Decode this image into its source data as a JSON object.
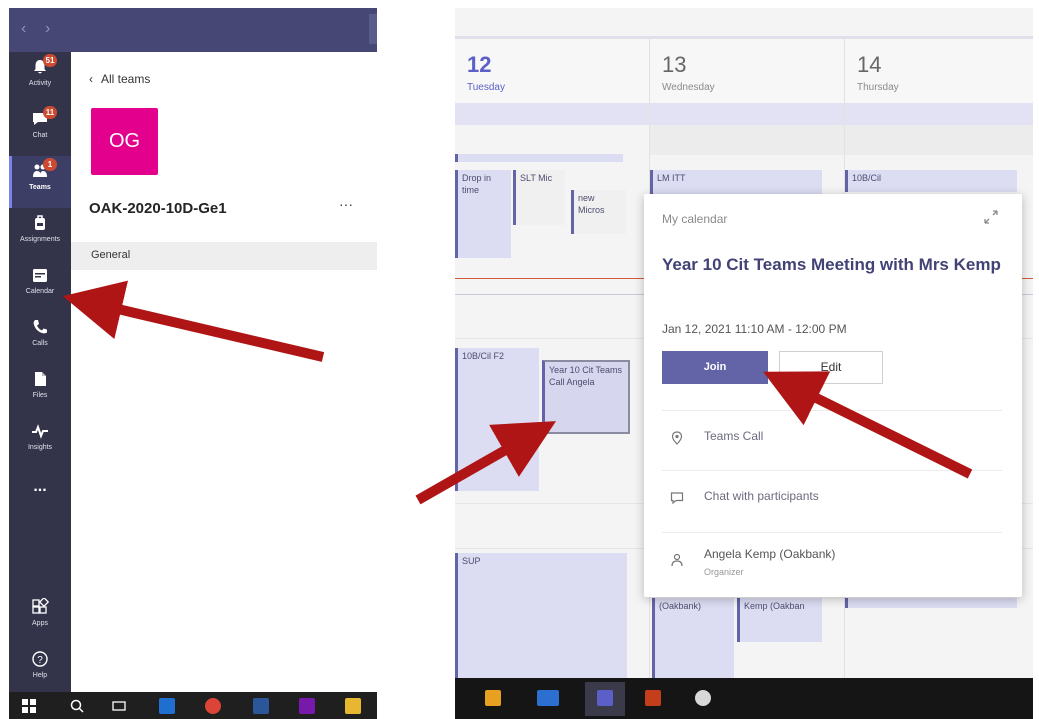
{
  "left": {
    "rail": [
      {
        "id": "activity",
        "label": "Activity",
        "badge": "51",
        "icon": "bell-icon"
      },
      {
        "id": "chat",
        "label": "Chat",
        "badge": "11",
        "icon": "chat-icon"
      },
      {
        "id": "teams",
        "label": "Teams",
        "badge": "1",
        "icon": "teams-icon",
        "active": true
      },
      {
        "id": "assignments",
        "label": "Assignments",
        "icon": "backpack-icon"
      },
      {
        "id": "calendar",
        "label": "Calendar",
        "icon": "calendar-icon"
      },
      {
        "id": "calls",
        "label": "Calls",
        "icon": "phone-icon"
      },
      {
        "id": "files",
        "label": "Files",
        "icon": "file-icon"
      },
      {
        "id": "insights",
        "label": "Insights",
        "icon": "pulse-icon"
      },
      {
        "id": "more",
        "label": "...",
        "icon": "more-icon"
      },
      {
        "id": "apps",
        "label": "Apps",
        "icon": "apps-icon"
      },
      {
        "id": "help",
        "label": "Help",
        "icon": "help-icon"
      }
    ],
    "all_teams": "All teams",
    "team_initials": "OG",
    "team_name": "OAK-2020-10D-Ge1",
    "more_dots": "···",
    "channel": "General",
    "colors": {
      "rail": "#33344a",
      "titlebar": "#464775",
      "avatar": "#e3008c",
      "badge": "#cc4a31"
    }
  },
  "calendar": {
    "days": [
      {
        "num": "12",
        "name": "Tuesday",
        "today": true
      },
      {
        "num": "13",
        "name": "Wednesday"
      },
      {
        "num": "14",
        "name": "Thursday"
      }
    ],
    "events": {
      "drop_in": "Drop in time",
      "slt": "SLT Mic",
      "new": "new Micros",
      "lm_itt": "LM ITT",
      "cl_14": "10B/Cil",
      "cl_12": "10B/Cil F2",
      "year10": "Year 10 Cit Teams Call Angela",
      "sup": "SUP",
      "kemp_a": "(Oakbank)",
      "kemp_b": "Kemp (Oakban"
    },
    "popup": {
      "header": "My calendar",
      "title": "Year 10 Cit Teams Meeting with Mrs Kemp",
      "datetime": "Jan 12, 2021 11:10 AM - 12:00 PM",
      "join": "Join",
      "edit": "Edit",
      "location": "Teams Call",
      "chat": "Chat with participants",
      "organizer_name": "Angela Kemp (Oakbank)",
      "organizer_role": "Organizer"
    },
    "colors": {
      "accent": "#6264a7",
      "event_bg": "#dcdcf2",
      "arrow": "#b01515"
    }
  }
}
